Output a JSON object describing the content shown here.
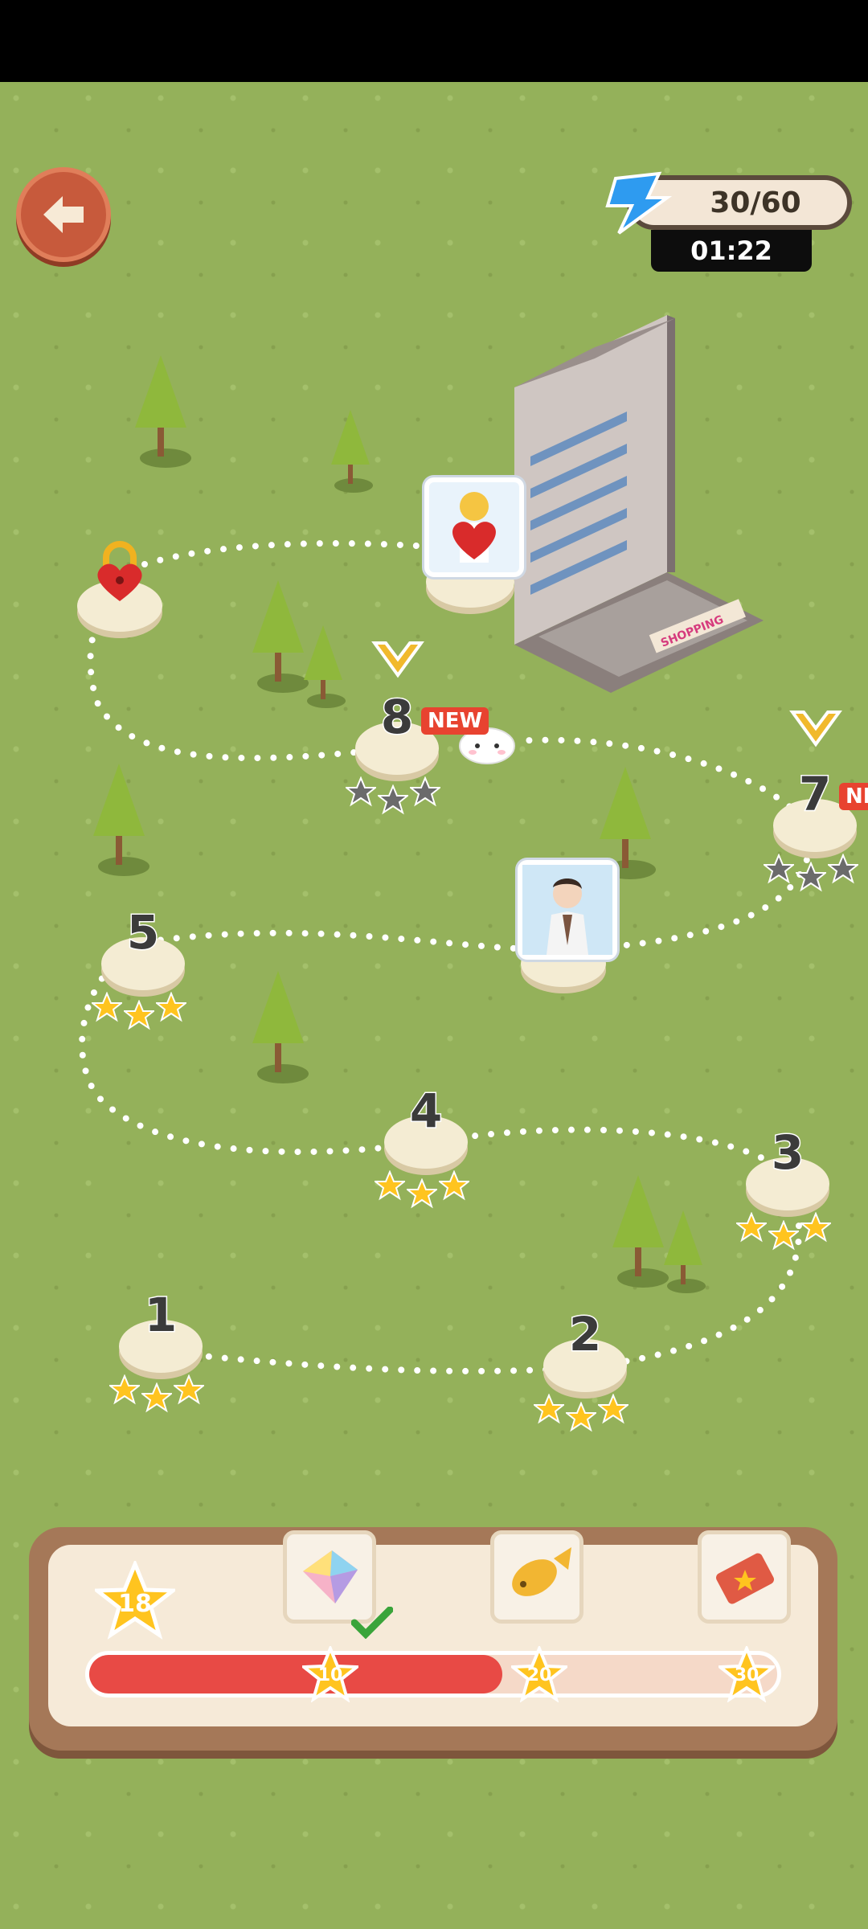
{
  "hud": {
    "energy_text": "30/60",
    "timer_text": "01:22"
  },
  "levels": [
    {
      "number": "1",
      "stars": 3
    },
    {
      "number": "2",
      "stars": 3
    },
    {
      "number": "3",
      "stars": 3
    },
    {
      "number": "4",
      "stars": 3
    },
    {
      "number": "5",
      "stars": 3
    },
    {
      "number": "7",
      "stars": 0,
      "badge": "NEW"
    },
    {
      "number": "8",
      "stars": 0,
      "badge": "NEW"
    }
  ],
  "building": {
    "sign": "SHOPPING"
  },
  "rewards": {
    "current_stars": "18",
    "progress": 0.6,
    "milestones": [
      "10",
      "20",
      "30"
    ],
    "items": [
      "crystal-icon",
      "fish-icon",
      "ticket-icon"
    ]
  },
  "colors": {
    "accent": "#e84a45",
    "star_gold": "#ffc41f",
    "star_gray": "#6b6b6b",
    "grass": "#94b15a"
  }
}
